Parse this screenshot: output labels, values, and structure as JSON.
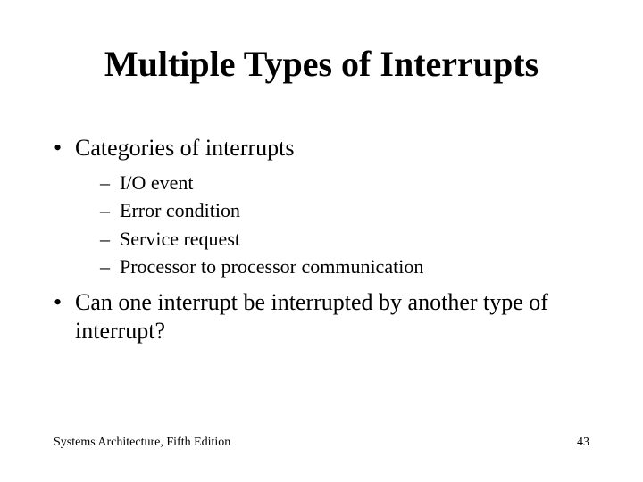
{
  "title": "Multiple Types of Interrupts",
  "bullets": {
    "item1": "Categories of interrupts",
    "sub1": "I/O event",
    "sub2": "Error condition",
    "sub3": "Service request",
    "sub4": "Processor to processor communication",
    "item2": "Can one interrupt be interrupted by another type of interrupt?"
  },
  "footer": {
    "source": "Systems Architecture, Fifth Edition",
    "page": "43"
  }
}
